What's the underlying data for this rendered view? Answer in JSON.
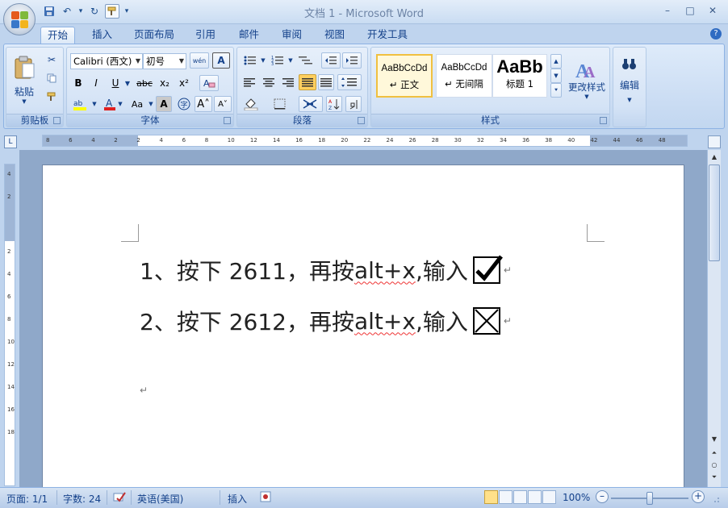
{
  "window": {
    "title": "文档 1 - Microsoft Word",
    "minimize": "–",
    "maximize": "□",
    "close": "✕"
  },
  "qat": {
    "save": "💾",
    "undo": "↶",
    "undo_drop": "▾",
    "redo": "↻",
    "customize": "▾"
  },
  "tabs": [
    {
      "label": "开始",
      "active": true
    },
    {
      "label": "插入"
    },
    {
      "label": "页面布局"
    },
    {
      "label": "引用"
    },
    {
      "label": "邮件"
    },
    {
      "label": "审阅"
    },
    {
      "label": "视图"
    },
    {
      "label": "开发工具"
    }
  ],
  "ribbon": {
    "clipboard": {
      "label": "剪贴板",
      "paste": "粘贴"
    },
    "font": {
      "label": "字体",
      "font_name": "Calibri (西文)",
      "font_size": "初号",
      "phonetic": "wén",
      "bold": "B",
      "italic": "I",
      "underline": "U",
      "strike": "abc",
      "sub": "x₂",
      "sup": "x²",
      "clear": "A",
      "grow": "A˄",
      "shrink": "A˅",
      "case": "Aa",
      "shade": "A",
      "encircle": "字"
    },
    "paragraph": {
      "label": "段落"
    },
    "styles": {
      "label": "样式",
      "items": [
        {
          "sample": "AaBbCcDd",
          "name": "↵ 正文",
          "selected": true
        },
        {
          "sample": "AaBbCcDd",
          "name": "↵ 无间隔"
        },
        {
          "sample": "AaBb",
          "name": "标题 1"
        }
      ],
      "change_styles": "更改样式"
    },
    "editing": {
      "label": "编辑"
    }
  },
  "ruler": {
    "h_ticks": [
      "8",
      "6",
      "4",
      "2",
      "2",
      "4",
      "6",
      "8",
      "10",
      "12",
      "14",
      "16",
      "18",
      "20",
      "22",
      "24",
      "26",
      "28",
      "30",
      "32",
      "34",
      "36",
      "38",
      "40",
      "42",
      "44",
      "46",
      "48"
    ],
    "v_ticks": [
      "4",
      "2",
      "2",
      "4",
      "6",
      "8",
      "10",
      "12",
      "14",
      "16",
      "18"
    ]
  },
  "document": {
    "lines": [
      {
        "prefix": "1、按下 2611，再按 ",
        "squiggle": "alt+x",
        "suffix": ",输入",
        "symbol": "checked-box"
      },
      {
        "prefix": "2、按下 2612，再按 ",
        "squiggle": "alt+x",
        "suffix": ",输入",
        "symbol": "x-box"
      }
    ],
    "para_mark": "↵"
  },
  "status": {
    "page": "页面: 1/1",
    "words": "字数: 24",
    "language": "英语(美国)",
    "mode": "插入",
    "zoom": "100%",
    "zoom_minus": "–",
    "zoom_plus": "+",
    "zoom_level": 0.5
  }
}
